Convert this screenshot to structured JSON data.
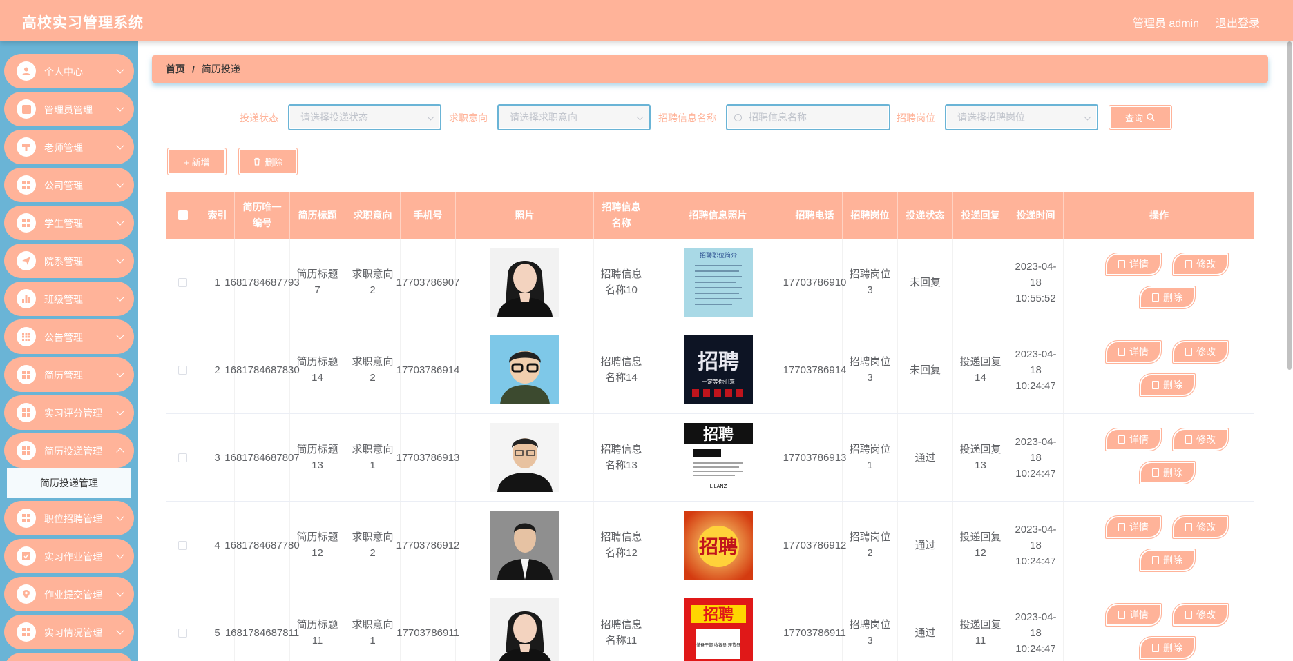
{
  "app_title": "高校实习管理系统",
  "user": {
    "role_label": "管理员 admin",
    "logout_label": "退出登录"
  },
  "sidebar": {
    "items": [
      {
        "label": "个人中心",
        "icon": "user-icon"
      },
      {
        "label": "管理员管理",
        "icon": "clipboard-icon"
      },
      {
        "label": "老师管理",
        "icon": "podium-icon"
      },
      {
        "label": "公司管理",
        "icon": "grid-icon"
      },
      {
        "label": "学生管理",
        "icon": "grid-icon"
      },
      {
        "label": "院系管理",
        "icon": "paper-plane-icon"
      },
      {
        "label": "班级管理",
        "icon": "bar-chart-icon"
      },
      {
        "label": "公告管理",
        "icon": "apps-icon"
      },
      {
        "label": "简历管理",
        "icon": "grid-icon"
      },
      {
        "label": "实习评分管理",
        "icon": "grid-icon"
      },
      {
        "label": "简历投递管理",
        "icon": "grid-icon"
      },
      {
        "label": "职位招聘管理",
        "icon": "grid-icon"
      },
      {
        "label": "实习作业管理",
        "icon": "checkbox-icon"
      },
      {
        "label": "作业提交管理",
        "icon": "location-icon"
      },
      {
        "label": "实习情况管理",
        "icon": "grid-icon"
      }
    ],
    "active_sub": "简历投递管理"
  },
  "breadcrumb": {
    "home": "首页",
    "sep": "/",
    "current": "简历投递"
  },
  "filters": {
    "status_label": "投递状态",
    "status_placeholder": "请选择投递状态",
    "intent_label": "求职意向",
    "intent_placeholder": "请选择求职意向",
    "name_label": "招聘信息名称",
    "name_placeholder": "招聘信息名称",
    "post_label": "招聘岗位",
    "post_placeholder": "请选择招聘岗位",
    "query_label": "查询"
  },
  "toolbar": {
    "add_label": "+ 新增",
    "delete_label": "删除"
  },
  "table": {
    "headers": [
      "索引",
      "简历唯一编号",
      "简历标题",
      "求职意向",
      "手机号",
      "照片",
      "招聘信息名称",
      "招聘信息照片",
      "招聘电话",
      "招聘岗位",
      "投递状态",
      "投递回复",
      "投递时间",
      "操作"
    ],
    "rows": [
      {
        "idx": "1",
        "code": "1681784687793",
        "title": "简历标题7",
        "intent": "求职意向2",
        "phone": "17703786907",
        "name": "招聘信息名称10",
        "rphone": "17703786910",
        "post": "招聘岗位3",
        "status": "未回复",
        "reply": "",
        "time": "2023-04-18 10:55:52"
      },
      {
        "idx": "2",
        "code": "1681784687830",
        "title": "简历标题14",
        "intent": "求职意向2",
        "phone": "17703786914",
        "name": "招聘信息名称14",
        "rphone": "17703786914",
        "post": "招聘岗位3",
        "status": "未回复",
        "reply": "投递回复14",
        "time": "2023-04-18 10:24:47"
      },
      {
        "idx": "3",
        "code": "1681784687807",
        "title": "简历标题13",
        "intent": "求职意向1",
        "phone": "17703786913",
        "name": "招聘信息名称13",
        "rphone": "17703786913",
        "post": "招聘岗位1",
        "status": "通过",
        "reply": "投递回复13",
        "time": "2023-04-18 10:24:47"
      },
      {
        "idx": "4",
        "code": "1681784687780",
        "title": "简历标题12",
        "intent": "求职意向2",
        "phone": "17703786912",
        "name": "招聘信息名称12",
        "rphone": "17703786912",
        "post": "招聘岗位2",
        "status": "通过",
        "reply": "投递回复12",
        "time": "2023-04-18 10:24:47"
      },
      {
        "idx": "5",
        "code": "1681784687811",
        "title": "简历标题11",
        "intent": "求职意向1",
        "phone": "17703786911",
        "name": "招聘信息名称11",
        "rphone": "17703786911",
        "post": "招聘岗位3",
        "status": "通过",
        "reply": "投递回复11",
        "time": "2023-04-18 10:24:47"
      }
    ],
    "actions": {
      "detail": "详情",
      "edit": "修改",
      "delete": "删除"
    }
  },
  "poster_texts": {
    "p1": "招聘职位简介",
    "p2": "招聘",
    "p2_sub": "一定等你们来",
    "p3": "招聘",
    "p3_sub": "LILANZ",
    "p4": "招聘",
    "p5": "招聘",
    "p5_sub": "储备干部 收银员 理货员"
  },
  "colors": {
    "accent": "#ffb399",
    "sidebar_bg": "#6ab4d6",
    "focus_border": "#6ab4d6"
  }
}
